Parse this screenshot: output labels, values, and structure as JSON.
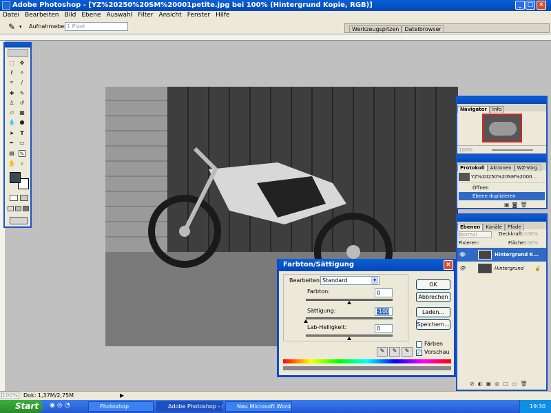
{
  "app": {
    "title": "Adobe Photoshop - [YZ%20250%20SM%20001petite.jpg bei 100% (Hintergrund Kopie, RGB)]"
  },
  "menu": [
    "Datei",
    "Bearbeiten",
    "Bild",
    "Ebene",
    "Auswahl",
    "Filter",
    "Ansicht",
    "Fenster",
    "Hilfe"
  ],
  "options": {
    "sample_label": "Aufnahmebereich:",
    "sample_value": "1 Pixel",
    "tab_brushes": "Werkzeugspitzen",
    "tab_browser": "Dateibrowser"
  },
  "navigator": {
    "tabs": [
      "Navigator",
      "Info"
    ],
    "zoom": "100%"
  },
  "history": {
    "tabs": [
      "Protokoll",
      "Aktionen",
      "WZ-Vorg."
    ],
    "snapshot": "YZ%20250%20SM%2000...",
    "items": [
      "Öffnen",
      "Ebene duplizieren"
    ]
  },
  "layers": {
    "tabs": [
      "Ebenen",
      "Kanäle",
      "Pfade"
    ],
    "blend_mode": "Normal",
    "opacity_label": "Deckkraft:",
    "opacity_value": "100%",
    "lock_label": "Fixieren:",
    "fill_label": "Fläche:",
    "fill_value": "100%",
    "items": [
      "Hintergrund K...",
      "Hintergrund"
    ]
  },
  "dialog": {
    "title": "Farbton/Sättigung",
    "edit_label": "Bearbeiten:",
    "edit_value": "Standard",
    "hue_label": "Farbton:",
    "hue_value": "0",
    "saturation_label": "Sättigung:",
    "saturation_value": "-100",
    "lightness_label": "Lab-Helligkeit:",
    "lightness_value": "0",
    "ok": "OK",
    "cancel": "Abbrechen",
    "load": "Laden...",
    "save": "Speichern...",
    "colorize_label": "Färben",
    "colorize_checked": false,
    "preview_label": "Vorschau",
    "preview_checked": true,
    "hue_level": 0.5,
    "saturation_level": 0.0,
    "lightness_level": 0.5
  },
  "status": {
    "zoom": "100%",
    "doc_info": "Dok: 1,37M/2,75M"
  },
  "taskbar": {
    "start": "Start",
    "tasks": [
      "Photoshop",
      "Adobe Photoshop - [...",
      "Neu Microsoft Word-..."
    ],
    "clock": "19:30"
  },
  "colors": {
    "xp_blue": "#0a5fd6",
    "panel_bg": "#ece9d8",
    "selection": "#316ac5"
  }
}
